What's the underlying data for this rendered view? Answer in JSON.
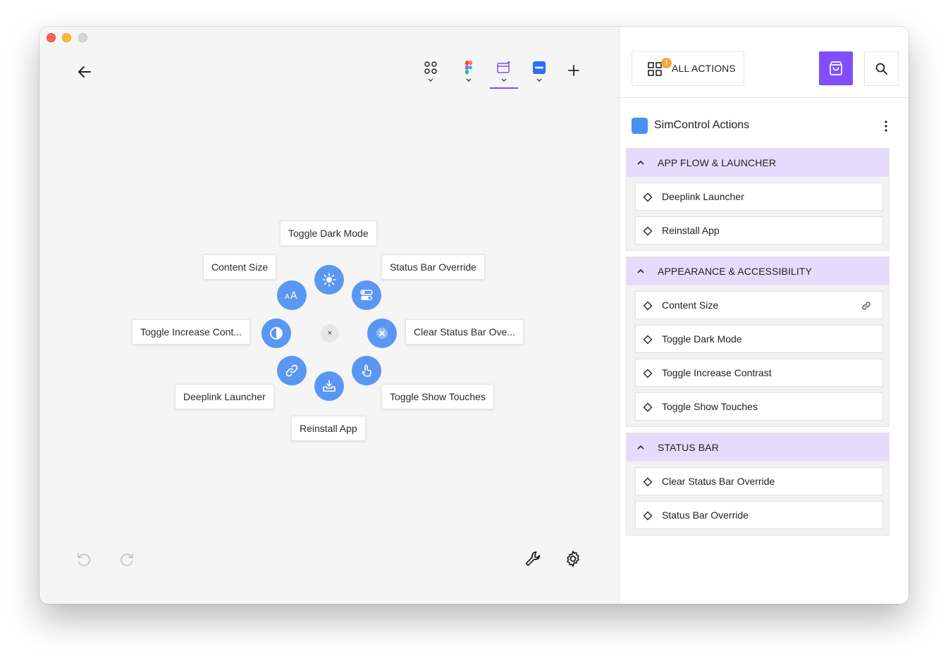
{
  "colors": {
    "accent": "#814eff",
    "radial_button": "#5a97f2",
    "group_header": "#e5dcfd",
    "badge": "#f3a53b"
  },
  "app_tabs": [
    {
      "name": "apps-grid-icon",
      "active": false
    },
    {
      "name": "figma-icon",
      "active": false
    },
    {
      "name": "simcontrol-icon",
      "active": true
    },
    {
      "name": "zoom-icon",
      "active": false
    }
  ],
  "radial": {
    "center_label": "×",
    "labels": {
      "top": "Toggle Dark Mode",
      "top_right": "Status Bar Override",
      "right": "Clear Status Bar Ove...",
      "bottom_right": "Toggle Show Touches",
      "bottom": "Reinstall App",
      "bottom_left": "Deeplink Launcher",
      "left": "Toggle Increase Cont...",
      "top_left": "Content Size"
    },
    "icons": {
      "top": "sun-icon",
      "top_right": "toggle-switches-icon",
      "right": "x-circle-icon",
      "bottom_right": "touch-hand-icon",
      "bottom": "tray-download-icon",
      "bottom_left": "link-icon",
      "left": "contrast-icon",
      "top_left": "text-size-icon"
    }
  },
  "panel": {
    "all_actions_label": "ALL ACTIONS",
    "badge": "!",
    "plugin_title": "SimControl Actions",
    "groups": [
      {
        "title": "APP FLOW & LAUNCHER",
        "items": [
          "Deeplink Launcher",
          "Reinstall App"
        ]
      },
      {
        "title": "APPEARANCE & ACCESSIBILITY",
        "items": [
          "Content Size",
          "Toggle Dark Mode",
          "Toggle Increase Contrast",
          "Toggle Show Touches"
        ]
      },
      {
        "title": "STATUS BAR",
        "items": [
          "Clear Status Bar Override",
          "Status Bar Override"
        ]
      }
    ]
  }
}
